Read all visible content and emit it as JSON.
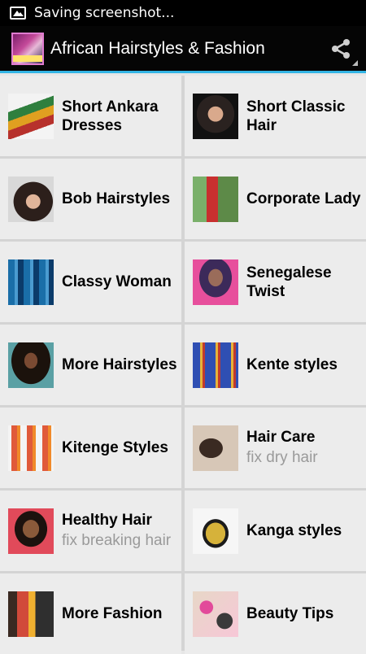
{
  "status_bar": {
    "text": "Saving screenshot..."
  },
  "app_bar": {
    "title": "African Hairstyles & Fashion",
    "share_icon": "share-icon"
  },
  "tiles": [
    {
      "title": "Short Ankara Dresses",
      "subtitle": "",
      "image": "ankara-dresses-thumb"
    },
    {
      "title": "Short Classic Hair",
      "subtitle": "",
      "image": "classic-hair-thumb"
    },
    {
      "title": "Bob Hairstyles",
      "subtitle": "",
      "image": "bob-hairstyles-thumb"
    },
    {
      "title": "Corporate Lady",
      "subtitle": "",
      "image": "corporate-lady-thumb"
    },
    {
      "title": "Classy Woman",
      "subtitle": "",
      "image": "classy-woman-thumb"
    },
    {
      "title": "Senegalese Twist",
      "subtitle": "",
      "image": "senegalese-twist-thumb"
    },
    {
      "title": "More Hairstyles",
      "subtitle": "",
      "image": "more-hairstyles-thumb"
    },
    {
      "title": "Kente styles",
      "subtitle": "",
      "image": "kente-styles-thumb"
    },
    {
      "title": "Kitenge Styles",
      "subtitle": "",
      "image": "kitenge-styles-thumb"
    },
    {
      "title": "Hair Care",
      "subtitle": "fix dry hair",
      "image": "hair-care-thumb"
    },
    {
      "title": "Healthy Hair",
      "subtitle": "fix breaking hair",
      "image": "healthy-hair-thumb"
    },
    {
      "title": "Kanga styles",
      "subtitle": "",
      "image": "kanga-styles-thumb"
    },
    {
      "title": "More Fashion",
      "subtitle": "",
      "image": "more-fashion-thumb"
    },
    {
      "title": "Beauty Tips",
      "subtitle": "",
      "image": "beauty-tips-thumb"
    }
  ],
  "colors": {
    "accent": "#33b5e5",
    "tile_bg": "#ececec",
    "subtitle": "#9a9a9a"
  }
}
